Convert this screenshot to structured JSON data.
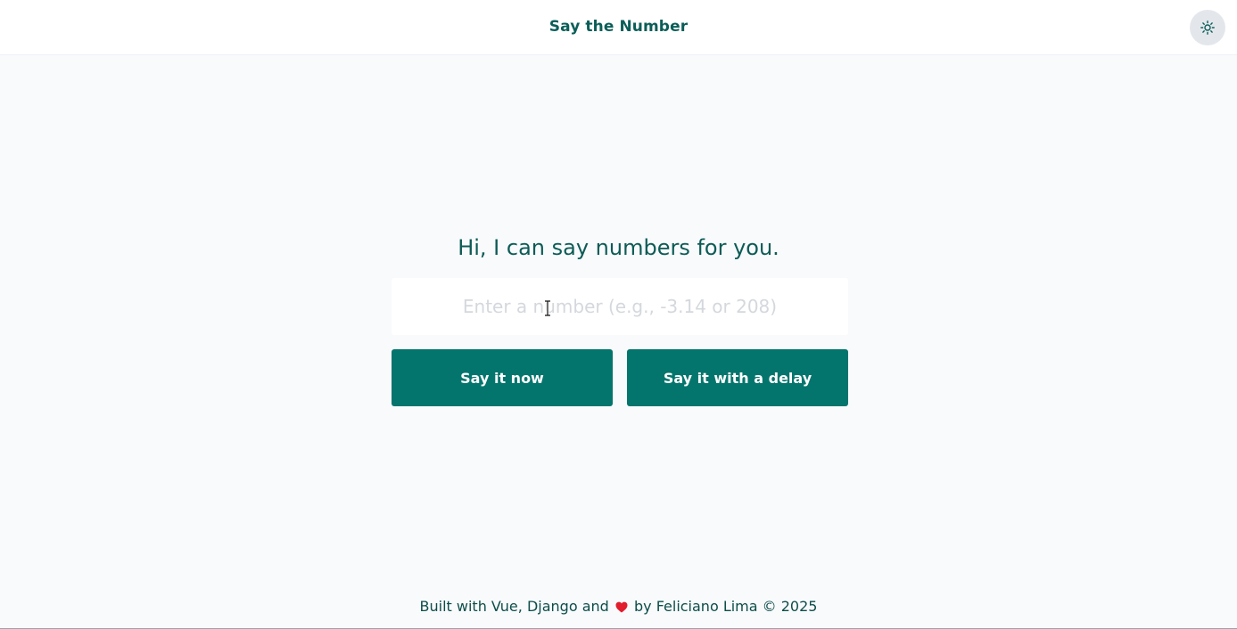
{
  "header": {
    "title": "Say the Number",
    "theme_toggle_icon": "sun-icon"
  },
  "main": {
    "greeting": "Hi, I can say numbers for you.",
    "input": {
      "value": "",
      "placeholder": "Enter a number (e.g., -3.14 or 208)"
    },
    "buttons": {
      "say_now": "Say it now",
      "say_delay": "Say it with a delay"
    }
  },
  "footer": {
    "before_heart": "Built with Vue, Django and",
    "heart_icon": "heart-icon",
    "after_heart": "by Feliciano Lima © 2025"
  },
  "colors": {
    "accent": "#04756d",
    "title": "#0b5e58",
    "background": "#f8fafc",
    "heart": "#e11d2e"
  }
}
